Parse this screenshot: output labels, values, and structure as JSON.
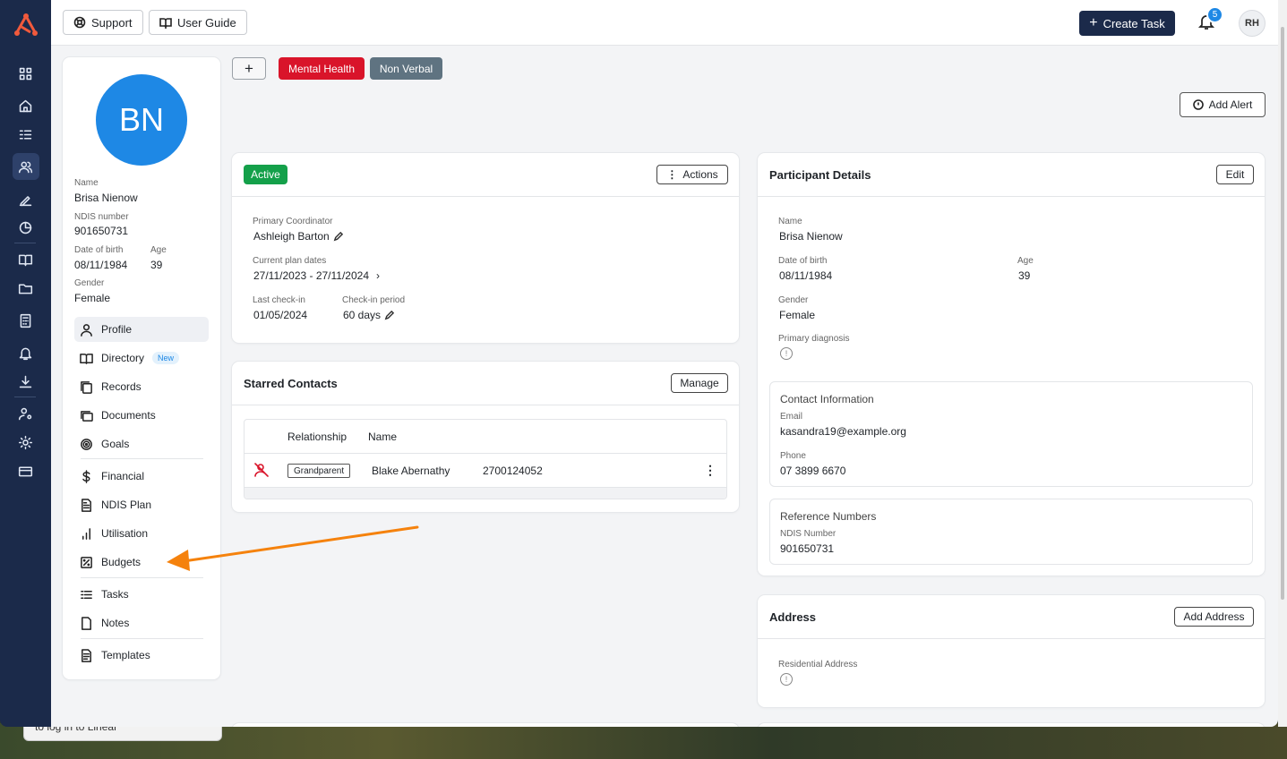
{
  "background": {
    "popup_text": "to log in to Linear"
  },
  "topbar": {
    "support_label": "Support",
    "guide_label": "User Guide",
    "create_task_label": "Create Task",
    "notification_count": "5",
    "user_initials": "RH"
  },
  "profile": {
    "initials": "BN",
    "name_label": "Name",
    "name": "Brisa Nienow",
    "ndis_label": "NDIS number",
    "ndis": "901650731",
    "dob_label": "Date of birth",
    "dob": "08/11/1984",
    "age_label": "Age",
    "age": "39",
    "gender_label": "Gender",
    "gender": "Female"
  },
  "nav": {
    "profile": "Profile",
    "directory": "Directory",
    "directory_badge": "New",
    "records": "Records",
    "documents": "Documents",
    "goals": "Goals",
    "financial": "Financial",
    "ndis_plan": "NDIS Plan",
    "utilisation": "Utilisation",
    "budgets": "Budgets",
    "tasks": "Tasks",
    "notes": "Notes",
    "templates": "Templates"
  },
  "tags": {
    "add": "+",
    "mental_health": "Mental Health",
    "non_verbal": "Non Verbal",
    "mental_health_color": "#d9142a",
    "non_verbal_color": "#5f7381"
  },
  "add_alert_label": "Add Alert",
  "status_card": {
    "status": "Active",
    "actions_label": "Actions",
    "coordinator_label": "Primary Coordinator",
    "coordinator": "Ashleigh Barton",
    "plan_dates_label": "Current plan dates",
    "plan_dates": "27/11/2023 - 27/11/2024",
    "checkin_label": "Last check-in",
    "checkin": "01/05/2024",
    "period_label": "Check-in period",
    "period": "60 days"
  },
  "starred": {
    "title": "Starred Contacts",
    "manage_label": "Manage",
    "col_relationship": "Relationship",
    "col_name": "Name",
    "rows": [
      {
        "relationship": "Grandparent",
        "name": "Blake Abernathy",
        "phone": "2700124052"
      }
    ]
  },
  "details": {
    "title": "Participant Details",
    "edit_label": "Edit",
    "name_label": "Name",
    "name": "Brisa Nienow",
    "dob_label": "Date of birth",
    "dob": "08/11/1984",
    "age_label": "Age",
    "age": "39",
    "gender_label": "Gender",
    "gender": "Female",
    "diagnosis_label": "Primary diagnosis",
    "contact_title": "Contact Information",
    "email_label": "Email",
    "email": "kasandra19@example.org",
    "phone_label": "Phone",
    "phone": "07 3899 6670",
    "ref_title": "Reference Numbers",
    "ref_ndis_label": "NDIS Number",
    "ref_ndis": "901650731"
  },
  "address": {
    "title": "Address",
    "add_label": "Add Address",
    "residential_label": "Residential Address"
  },
  "colors": {
    "rail": "#1b2a4a",
    "accent": "#1e88e5",
    "success": "#14a04a",
    "arrow": "#f5820d"
  }
}
